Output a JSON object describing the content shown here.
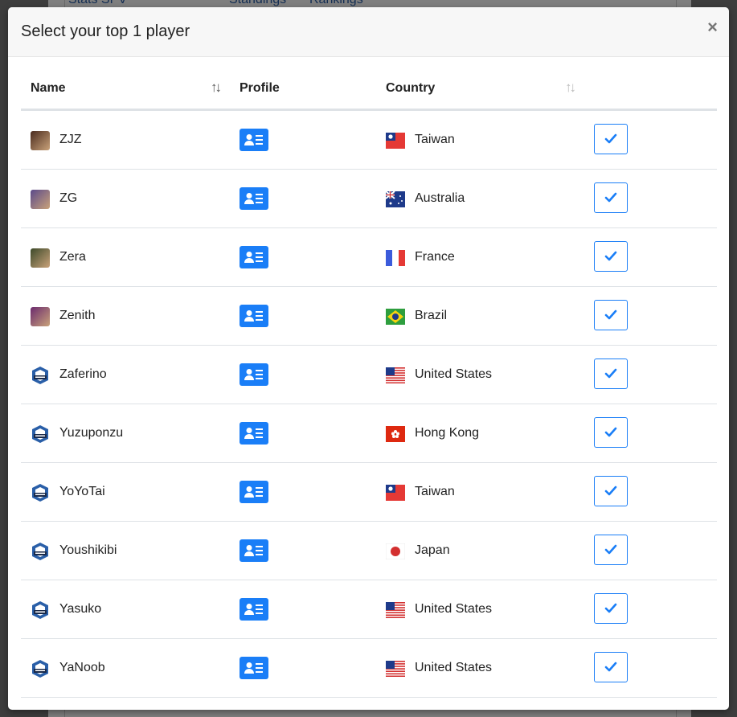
{
  "background_nav": {
    "item1": "Stats SPV",
    "item2": "Standings",
    "item3": "Rankings"
  },
  "modal": {
    "title": "Select your top 1 player",
    "close_symbol": "×"
  },
  "table": {
    "headers": {
      "name": "Name",
      "profile": "Profile",
      "country": "Country"
    },
    "sort_symbol": "↑↓",
    "rows": [
      {
        "name": "ZJZ",
        "country": "Taiwan",
        "flag": "taiwan",
        "avatar": "photo",
        "avatar_color": "#4a2b1e"
      },
      {
        "name": "ZG",
        "country": "Australia",
        "flag": "australia",
        "avatar": "photo",
        "avatar_color": "#5b4a8a"
      },
      {
        "name": "Zera",
        "country": "France",
        "flag": "france",
        "avatar": "photo",
        "avatar_color": "#3c4a2a"
      },
      {
        "name": "Zenith",
        "country": "Brazil",
        "flag": "brazil",
        "avatar": "photo",
        "avatar_color": "#6b2a6e"
      },
      {
        "name": "Zaferino",
        "country": "United States",
        "flag": "usa",
        "avatar": "logo",
        "avatar_color": "#2a5fa8"
      },
      {
        "name": "Yuzuponzu",
        "country": "Hong Kong",
        "flag": "hongkong",
        "avatar": "logo",
        "avatar_color": "#2a5fa8"
      },
      {
        "name": "YoYoTai",
        "country": "Taiwan",
        "flag": "taiwan",
        "avatar": "logo",
        "avatar_color": "#2a5fa8"
      },
      {
        "name": "Youshikibi",
        "country": "Japan",
        "flag": "japan",
        "avatar": "logo",
        "avatar_color": "#2a5fa8"
      },
      {
        "name": "Yasuko",
        "country": "United States",
        "flag": "usa",
        "avatar": "logo",
        "avatar_color": "#2a5fa8"
      },
      {
        "name": "YaNoob",
        "country": "United States",
        "flag": "usa",
        "avatar": "logo",
        "avatar_color": "#2a5fa8"
      }
    ]
  },
  "colors": {
    "accent": "#1a7ef7"
  },
  "icons": {
    "profile": "id-card-icon",
    "select": "checkmark-icon",
    "close": "close-icon",
    "sort": "sort-icon"
  }
}
